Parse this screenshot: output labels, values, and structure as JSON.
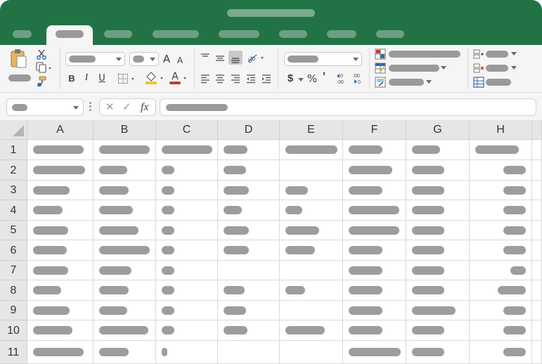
{
  "columns": [
    "A",
    "B",
    "C",
    "D",
    "E",
    "F",
    "G",
    "H"
  ],
  "rows": [
    "1",
    "2",
    "3",
    "4",
    "5",
    "6",
    "7",
    "8",
    "9",
    "10",
    "11"
  ],
  "ribbon": {
    "font_size_up": "A",
    "font_size_down": "A",
    "bold": "B",
    "italic": "I",
    "underline": "U",
    "font_color_letter": "A",
    "currency": "$",
    "percent": "%",
    "comma": "’",
    "inc_decimal": ".0",
    "dec_decimal": ".00",
    "accent_red": "#d0352b",
    "accent_yellow": "#f2c230"
  },
  "formula_bar": {
    "cancel": "✕",
    "enter": "✓",
    "fx": "fx"
  },
  "colors": {
    "brand_green": "#217346",
    "placeholder_gray": "#9d9d9d"
  },
  "icons": [
    "paste-icon",
    "cut-icon",
    "copy-icon",
    "format-painter-icon",
    "borders-icon",
    "fill-color-icon",
    "font-color-icon",
    "align-top-icon",
    "align-middle-icon",
    "align-bottom-icon",
    "orientation-icon",
    "align-left-icon",
    "align-center-icon",
    "align-right-icon",
    "decrease-indent-icon",
    "increase-indent-icon",
    "conditional-format-icon",
    "format-table-icon",
    "cell-styles-icon",
    "insert-cells-icon",
    "delete-cells-icon",
    "format-cells-icon"
  ]
}
